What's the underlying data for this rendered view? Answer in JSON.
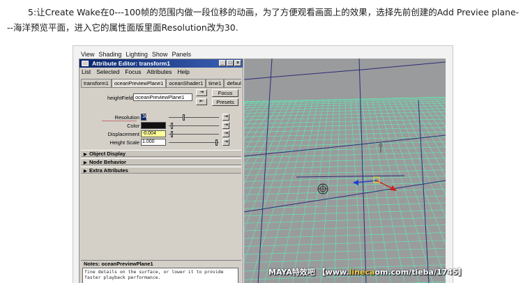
{
  "intro": {
    "text": "5:让Create Wake在0---100帧的范围内做一段位移的动画，为了方便观看画面上的效果，选择先前创建的Add Previee plane---海洋预览平面，进入它的属性面版里面Resolution改为30."
  },
  "maya": {
    "main_menu": [
      "View",
      "Shading",
      "Lighting",
      "Show",
      "Panels"
    ],
    "attribute_editor": {
      "title": "Attribute Editor: transform1",
      "menu": [
        "List",
        "Selected",
        "Focus",
        "Attributes",
        "Help"
      ],
      "tabs": [
        "transform1",
        "oceanPreviewPlane1",
        "oceanShader1",
        "time1",
        "defaultRenderU"
      ],
      "active_tab": "oceanPreviewPlane1",
      "height_field_label": "heightField:",
      "height_field_value": "oceanPreviewPlane1",
      "focus_label": "Focus",
      "presets_label": "Presets",
      "attributes": [
        {
          "label": "Resolution",
          "value": "30",
          "slider": 0.3
        },
        {
          "label": "Color",
          "value": "",
          "slider": 0.05
        },
        {
          "label": "Displacement",
          "value": "-0.004",
          "slider": 0.05
        },
        {
          "label": "Height Scale",
          "value": "1.000",
          "slider": 0.98
        }
      ],
      "sections": [
        "Object Display",
        "Node Behavior",
        "Extra Attributes"
      ],
      "notes_title": "Notes: oceanPreviewPlane1",
      "notes_text": "fine details on the surface, or lower it to provide faster playback performance."
    }
  },
  "watermark": {
    "left": "MAYA特效吧",
    "url_prefix": "【www.",
    "url_highlight": "lineca",
    "url_rest": "om.com/tieba/1745】"
  },
  "colors": {
    "viewport_bg": "#9a9b9c",
    "ocean_grid": "#5cf0b6",
    "outline": "#2a2a7a",
    "title_bar": "#0a246a"
  }
}
